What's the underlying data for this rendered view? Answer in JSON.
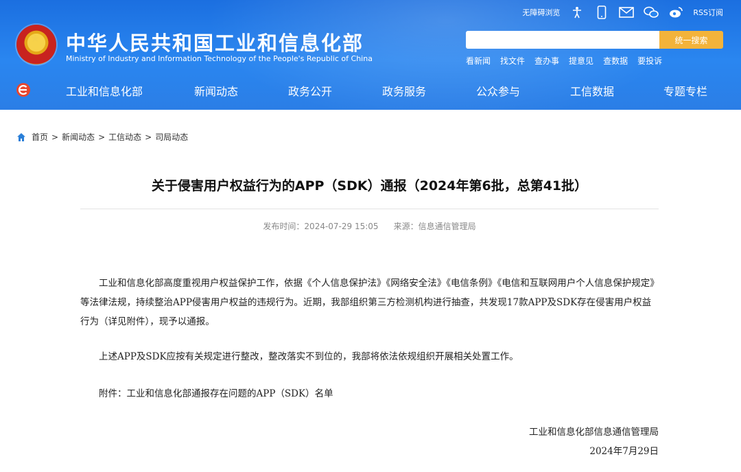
{
  "header": {
    "title": "中华人民共和国工业和信息化部",
    "subtitle": "Ministry of Industry and Information Technology of the People's Republic of China",
    "top_links": {
      "accessibility": "无障碍浏览",
      "rss": "RSS订阅"
    },
    "top_icons": [
      "accessibility-figure-icon",
      "mobile-icon",
      "mail-icon",
      "wechat-icon",
      "weibo-icon"
    ],
    "search": {
      "placeholder": "",
      "button_label": "统一搜索"
    },
    "quick_links": [
      "看新闻",
      "找文件",
      "查办事",
      "提意见",
      "查数据",
      "要投诉"
    ]
  },
  "nav": {
    "items": [
      "工业和信息化部",
      "新闻动态",
      "政务公开",
      "政务服务",
      "公众参与",
      "工信数据",
      "专题专栏"
    ]
  },
  "breadcrumb": [
    "首页",
    "新闻动态",
    "工信动态",
    "司局动态"
  ],
  "article": {
    "title": "关于侵害用户权益行为的APP（SDK）通报（2024年第6批，总第41批）",
    "publish_label": "发布时间：2024-07-29 15:05",
    "source_label": "来源：信息通信管理局",
    "paragraphs": [
      "工业和信息化部高度重视用户权益保护工作，依据《个人信息保护法》《网络安全法》《电信条例》《电信和互联网用户个人信息保护规定》等法律法规，持续整治APP侵害用户权益的违规行为。近期，我部组织第三方检测机构进行抽查，共发现17款APP及SDK存在侵害用户权益行为（详见附件），现予以通报。",
      "上述APP及SDK应按有关规定进行整改，整改落实不到位的，我部将依法依规组织开展相关处置工作。",
      "附件：工业和信息化部通报存在问题的APP（SDK）名单"
    ],
    "signature": "工业和信息化部信息通信管理局",
    "date": "2024年7月29日"
  },
  "colors": {
    "header_blue": "#2a86f0",
    "search_button": "#f3b33a",
    "emblem_red": "#c8231f",
    "emblem_gold": "#f7d24a"
  }
}
